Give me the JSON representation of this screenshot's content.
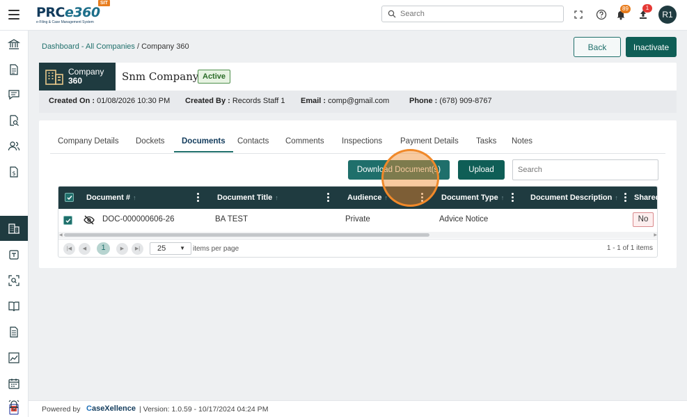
{
  "header": {
    "logo_text_main": "PRC",
    "logo_text_e": "e360",
    "logo_subtitle": "e-Filing & Case Management System",
    "env_badge": "SIT",
    "search_placeholder": "Search",
    "notifications_count": "89",
    "uploads_count": "1",
    "avatar_initials": "R1"
  },
  "sidebar": {
    "items": [
      {
        "icon": "bank-icon"
      },
      {
        "icon": "document-icon"
      },
      {
        "icon": "chat-icon"
      },
      {
        "icon": "document-search-icon"
      },
      {
        "icon": "users-icon"
      },
      {
        "icon": "dollar-document-icon"
      },
      {
        "icon": "building-icon",
        "active": true
      },
      {
        "icon": "tag-icon"
      },
      {
        "icon": "scan-search-icon"
      },
      {
        "icon": "book-open-icon"
      },
      {
        "icon": "file-text-icon"
      },
      {
        "icon": "chart-icon"
      },
      {
        "icon": "calendar-icon"
      },
      {
        "icon": "help-book-icon"
      },
      {
        "icon": "alarm-icon"
      }
    ]
  },
  "breadcrumb": {
    "link": "Dashboard - All Companies",
    "separator": " / ",
    "current": "Company 360"
  },
  "actions": {
    "back_label": "Back",
    "inactivate_label": "Inactivate"
  },
  "company": {
    "tag_line1": "Company",
    "tag_line2": "360",
    "name": "Snm Company",
    "status": "Active",
    "created_on_label": "Created On :",
    "created_on_value": "01/08/2026 10:30 PM",
    "created_by_label": "Created By :",
    "created_by_value": "Records Staff 1",
    "email_label": "Email :",
    "email_value": "comp@gmail.com",
    "phone_label": "Phone :",
    "phone_value": "(678) 909-8767"
  },
  "tabs": [
    {
      "label": "Company Details"
    },
    {
      "label": "Dockets"
    },
    {
      "label": "Documents",
      "active": true
    },
    {
      "label": "Contacts"
    },
    {
      "label": "Comments"
    },
    {
      "label": "Inspections"
    },
    {
      "label": "Payment Details"
    },
    {
      "label": "Tasks"
    },
    {
      "label": "Notes"
    }
  ],
  "documents": {
    "download_label": "Download Document(s)",
    "upload_label": "Upload",
    "search_placeholder": "Search",
    "columns": [
      "Document #",
      "Document Title",
      "Audience",
      "Document Type",
      "Document Description",
      "Shared"
    ],
    "sort_arrow": "↑",
    "rows": [
      {
        "number": "DOC-000000606-26",
        "title": "BA TEST",
        "audience": "Private",
        "type": "Advice Notice",
        "description": "",
        "shared": "No"
      }
    ],
    "pager": {
      "current_page": "1",
      "page_size": "25",
      "items_per_page_label": "items per page",
      "count_text": "1 - 1 of 1 items"
    }
  },
  "footer": {
    "powered_by": "Powered by",
    "brand_c": "C",
    "brand_rest": "aseXellence",
    "version": "|   Version: 1.0.59 - 10/17/2024 04:24 PM"
  }
}
